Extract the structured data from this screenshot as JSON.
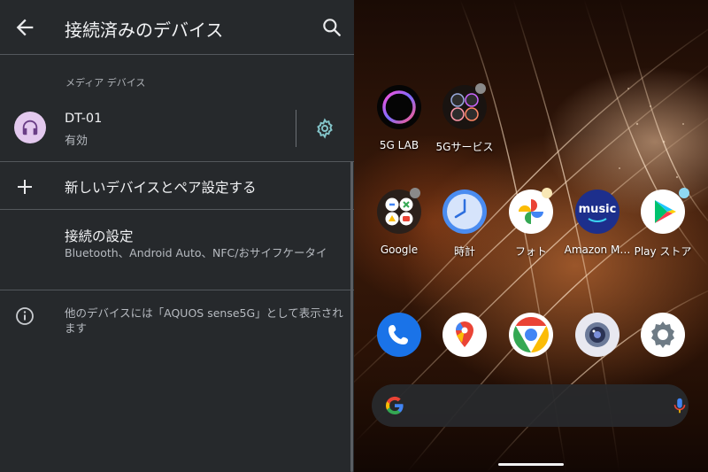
{
  "settings": {
    "title": "接続済みのデバイス",
    "section_header": "メディア デバイス",
    "device": {
      "name": "DT-01",
      "status": "有効"
    },
    "pair_new_label": "新しいデバイスとペア設定する",
    "connection_prefs": {
      "title": "接続の設定",
      "subtitle": "Bluetooth、Android Auto、NFC/おサイフケータイ"
    },
    "visibility_info": "他のデバイスには「AQUOS sense5G」として表示されます"
  },
  "home": {
    "row1": [
      {
        "label": "5G LAB",
        "icon": "ring-icon"
      },
      {
        "label": "5Gサービス",
        "icon": "folder-icon"
      }
    ],
    "row2": [
      {
        "label": "Google",
        "icon": "folder-icon"
      },
      {
        "label": "時計",
        "icon": "clock-icon"
      },
      {
        "label": "フォト",
        "icon": "photos-icon"
      },
      {
        "label": "Amazon M…",
        "icon": "amazon-music-icon",
        "icon_text": "music"
      },
      {
        "label": "Play ストア",
        "icon": "play-store-icon"
      }
    ],
    "dock": [
      {
        "icon": "phone-icon"
      },
      {
        "icon": "maps-icon"
      },
      {
        "icon": "chrome-icon"
      },
      {
        "icon": "camera-icon"
      },
      {
        "icon": "settings-gear-icon"
      }
    ],
    "colors": {
      "accent_avatar": "#e3c9ee",
      "accent_gear": "#83c4c9",
      "search_bar": "#282a2e"
    }
  }
}
